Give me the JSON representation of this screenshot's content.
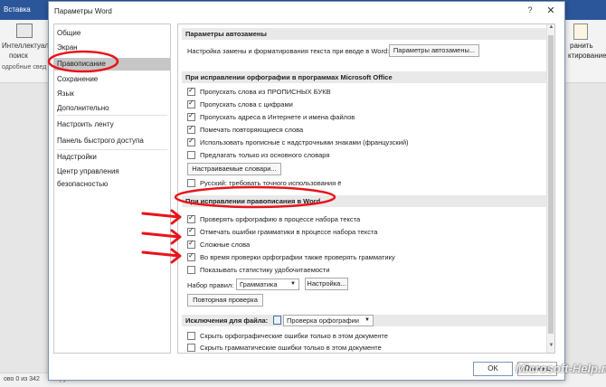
{
  "background": {
    "tab_insert": "Вставка",
    "left_group": {
      "line1": "Интеллектуальны",
      "line2": "поиск",
      "line3": "одробные свед"
    },
    "right_group": {
      "line1": "ранить",
      "line2": "ктирование"
    },
    "status": {
      "pages": "ово 0 из 342",
      "language": "русский"
    }
  },
  "dialog": {
    "title": "Параметры Word",
    "help": "?",
    "close": "✕",
    "ok": "OK",
    "cancel": "Отмена"
  },
  "nav": {
    "items": [
      "Общие",
      "Экран",
      "Правописание",
      "Сохранение",
      "Язык",
      "Дополнительно",
      "Настроить ленту",
      "Панель быстрого доступа",
      "Надстройки",
      "Центр управления безопасностью"
    ],
    "selected_index": 2
  },
  "content": {
    "autocorrect": {
      "header": "Параметры автозамены",
      "description": "Настройка замены и форматирования текста при вводе в Word:",
      "button": "Параметры автозамены..."
    },
    "office_spelling": {
      "header": "При исправлении орфографии в программах Microsoft Office",
      "options": [
        {
          "label": "Пропускать слова из ПРОПИСНЫХ БУКВ",
          "checked": true
        },
        {
          "label": "Пропускать слова с цифрами",
          "checked": true
        },
        {
          "label": "Пропускать адреса в Интернете и имена файлов",
          "checked": true
        },
        {
          "label": "Помечать повторяющиеся слова",
          "checked": true
        },
        {
          "label": "Использовать прописные с надстрочными знаками (французский)",
          "checked": true
        },
        {
          "label": "Предлагать только из основного словаря",
          "checked": false
        }
      ],
      "dictionaries_button": "Настраиваемые словари...",
      "russian_option": {
        "label": "Русский: требовать точного использования ё",
        "checked": false
      }
    },
    "word_spelling": {
      "header": "При исправлении правописания в Word",
      "options": [
        {
          "label": "Проверять орфографию в процессе набора текста",
          "checked": true
        },
        {
          "label": "Отмечать ошибки грамматики в процессе набора текста",
          "checked": true
        },
        {
          "label": "Сложные слова",
          "checked": true
        },
        {
          "label": "Во время проверки орфографии также проверять грамматику",
          "checked": true
        },
        {
          "label": "Показывать статистику удобочитаемости",
          "checked": false
        }
      ],
      "rules_label": "Набор правил:",
      "rules_value": "Грамматика",
      "settings_button": "Настройка...",
      "recheck_button": "Повторная проверка"
    },
    "exceptions": {
      "header": "Исключения для файла:",
      "file_value": "Проверка орфографии",
      "options": [
        {
          "label": "Скрыть орфографические ошибки только в этом документе",
          "checked": false
        },
        {
          "label": "Скрыть грамматические ошибки только в этом документе",
          "checked": false
        }
      ]
    }
  },
  "annotation_color": "#e8141c",
  "watermark": "Microsoft-Help.ru"
}
